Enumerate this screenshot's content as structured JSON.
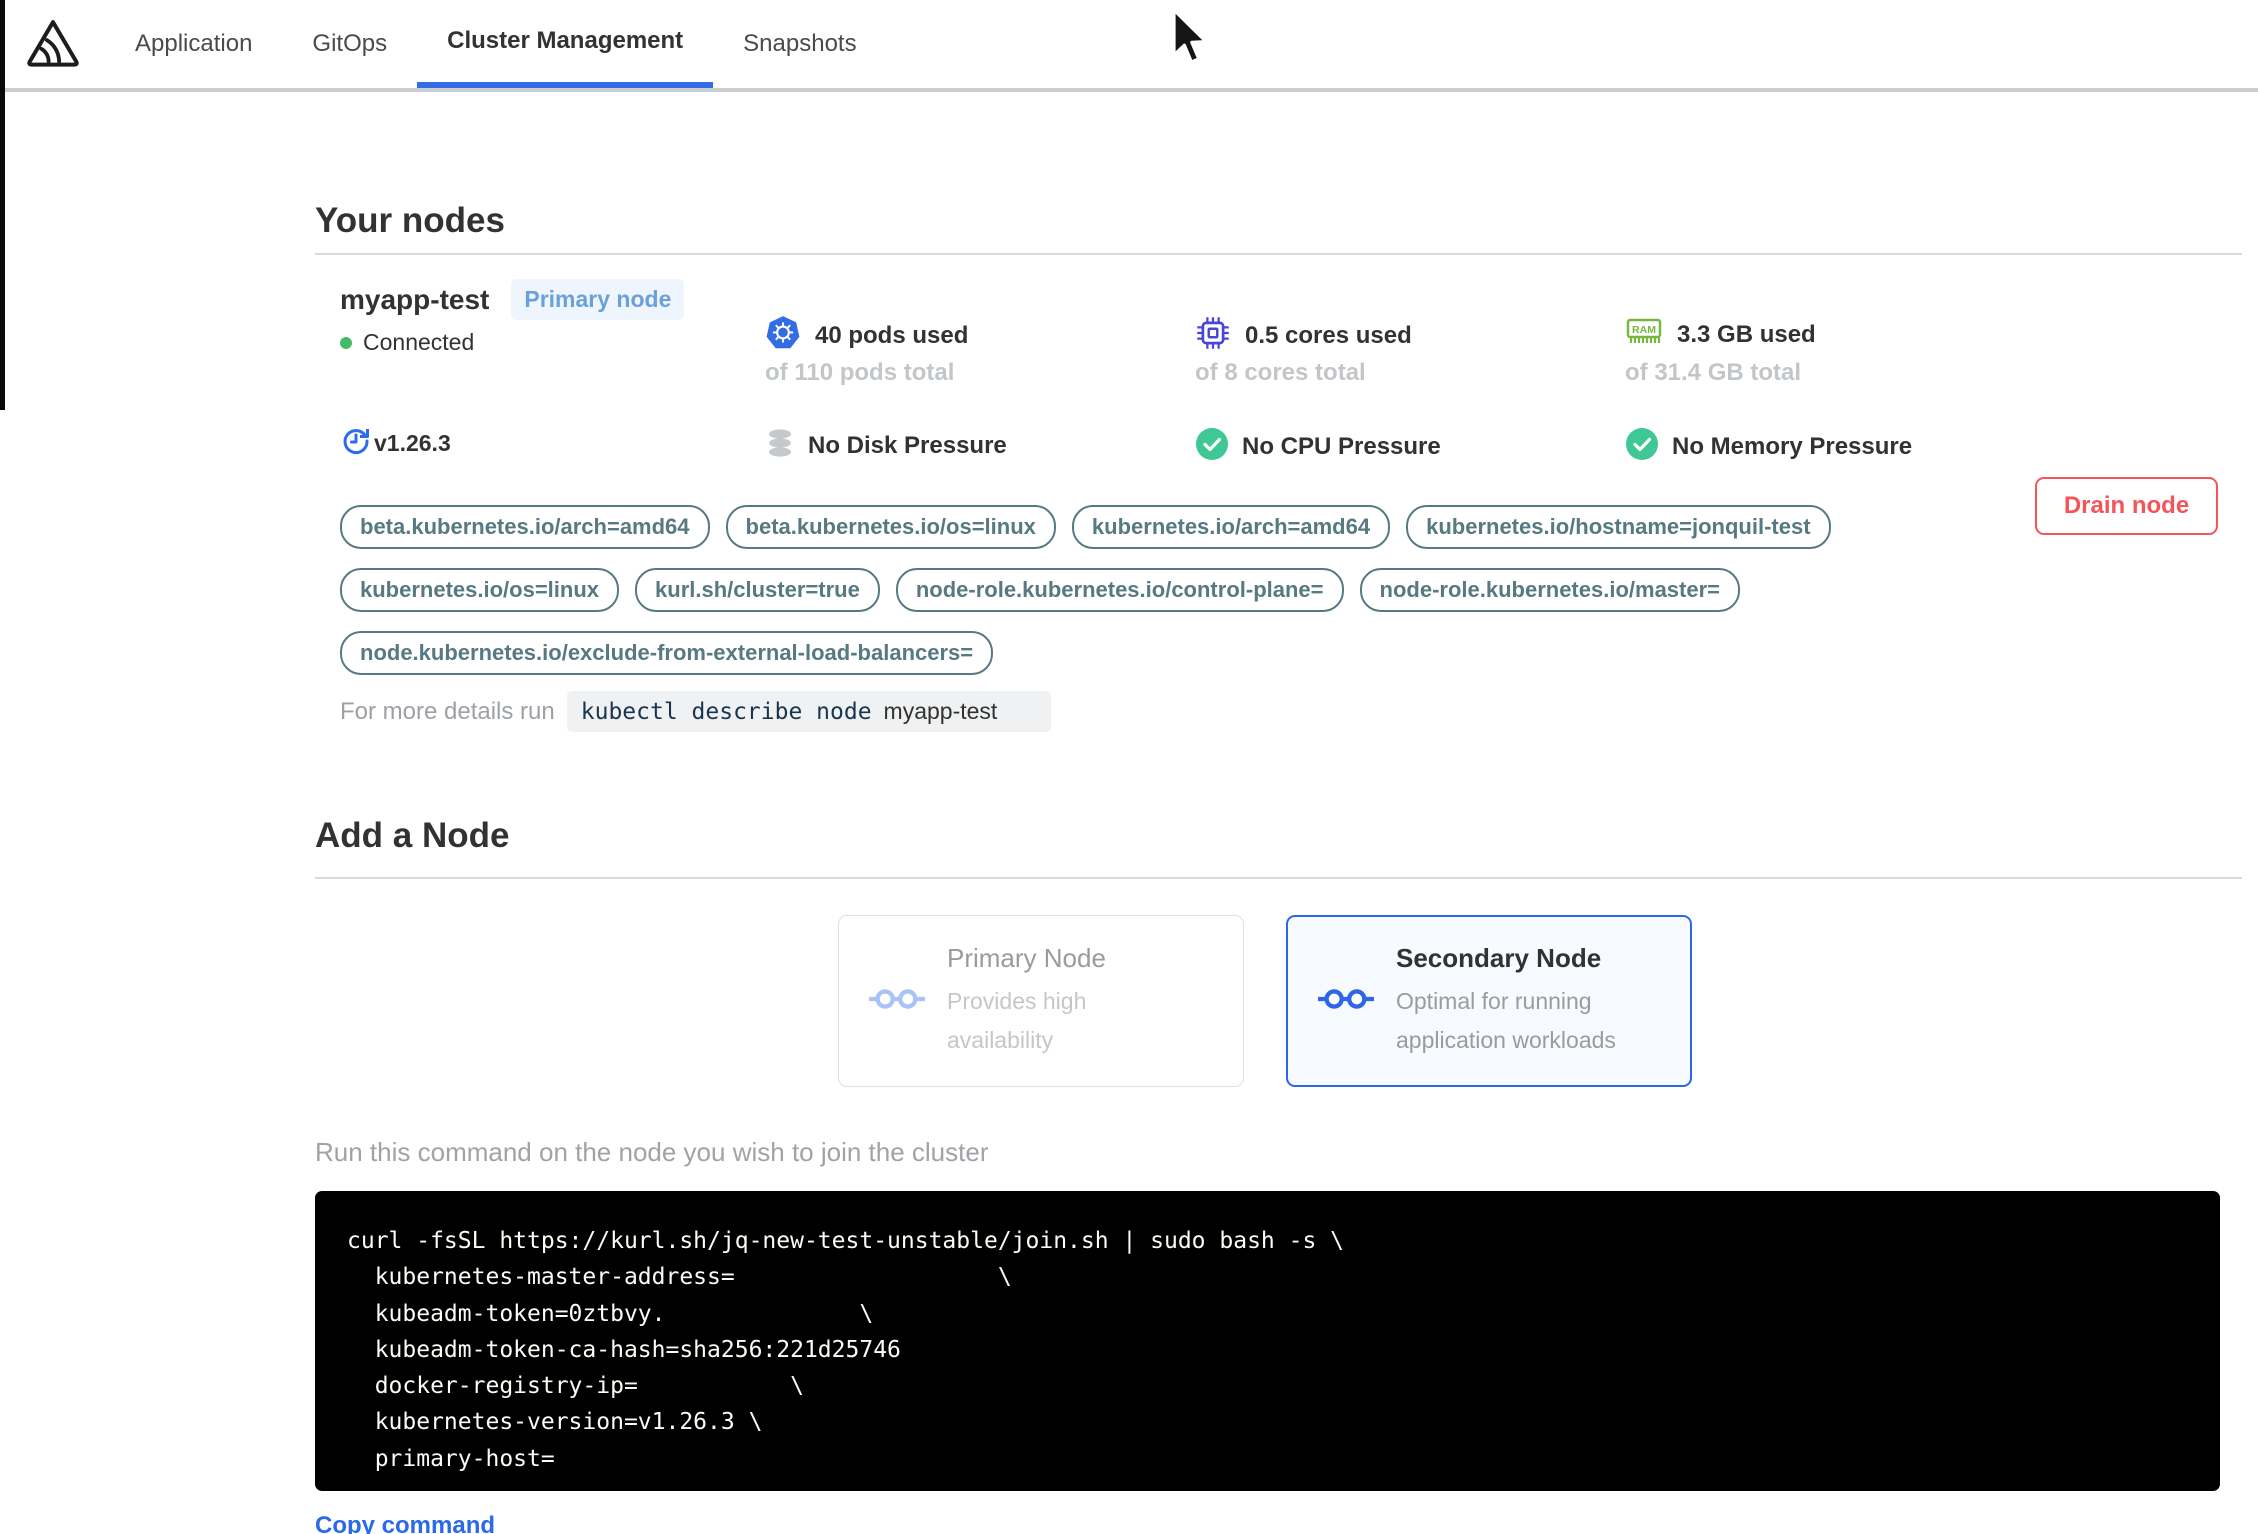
{
  "nav": {
    "tabs": [
      {
        "label": "Application",
        "active": false
      },
      {
        "label": "GitOps",
        "active": false
      },
      {
        "label": "Cluster Management",
        "active": true
      },
      {
        "label": "Snapshots",
        "active": false
      }
    ]
  },
  "your_nodes": {
    "title": "Your nodes",
    "node": {
      "name": "myapp-test",
      "badge": "Primary node",
      "status": "Connected",
      "version": "v1.26.3",
      "stats": [
        {
          "icon": "kubernetes-icon",
          "value": "40 pods used",
          "total": "of 110 pods total"
        },
        {
          "icon": "cpu-chip-icon",
          "value": "0.5 cores used",
          "total": "of 8 cores total"
        },
        {
          "icon": "ram-icon",
          "value": "3.3 GB used",
          "total": "of 31.4 GB total"
        }
      ],
      "pressures": [
        {
          "icon": "disk-icon",
          "label": "No Disk Pressure"
        },
        {
          "icon": "check-circle-icon",
          "label": "No CPU Pressure"
        },
        {
          "icon": "check-circle-icon",
          "label": "No Memory Pressure"
        }
      ],
      "labels": [
        "beta.kubernetes.io/arch=amd64",
        "beta.kubernetes.io/os=linux",
        "kubernetes.io/arch=amd64",
        "kubernetes.io/hostname=jonquil-test",
        "kubernetes.io/os=linux",
        "kurl.sh/cluster=true",
        "node-role.kubernetes.io/control-plane=",
        "node-role.kubernetes.io/master=",
        "node.kubernetes.io/exclude-from-external-load-balancers="
      ],
      "details_prefix": "For more details run",
      "details_command": "kubectl describe node",
      "details_node": "myapp-test",
      "drain_button": "Drain node"
    }
  },
  "add_node": {
    "title": "Add a Node",
    "options": [
      {
        "title": "Primary Node",
        "description": "Provides high availability",
        "selected": false
      },
      {
        "title": "Secondary Node",
        "description": "Optimal for running application workloads",
        "selected": true
      }
    ],
    "instruction": "Run this command on the node you wish to join the cluster",
    "command_lines": [
      "curl -fsSL https://kurl.sh/jq-new-test-unstable/join.sh | sudo bash -s \\",
      "  kubernetes-master-address=                   \\",
      "  kubeadm-token=0ztbvy.              \\",
      "  kubeadm-token-ca-hash=sha256:221d25746",
      "  docker-registry-ip=           \\",
      "  kubernetes-version=v1.26.3 \\",
      "  primary-host="
    ],
    "copy_label": "Copy command"
  },
  "colors": {
    "brand_blue": "#326de6",
    "danger_red": "#f4555a",
    "success_green": "#3fc795",
    "label_slate": "#577981",
    "badge_blue": "#6ba1d9"
  }
}
